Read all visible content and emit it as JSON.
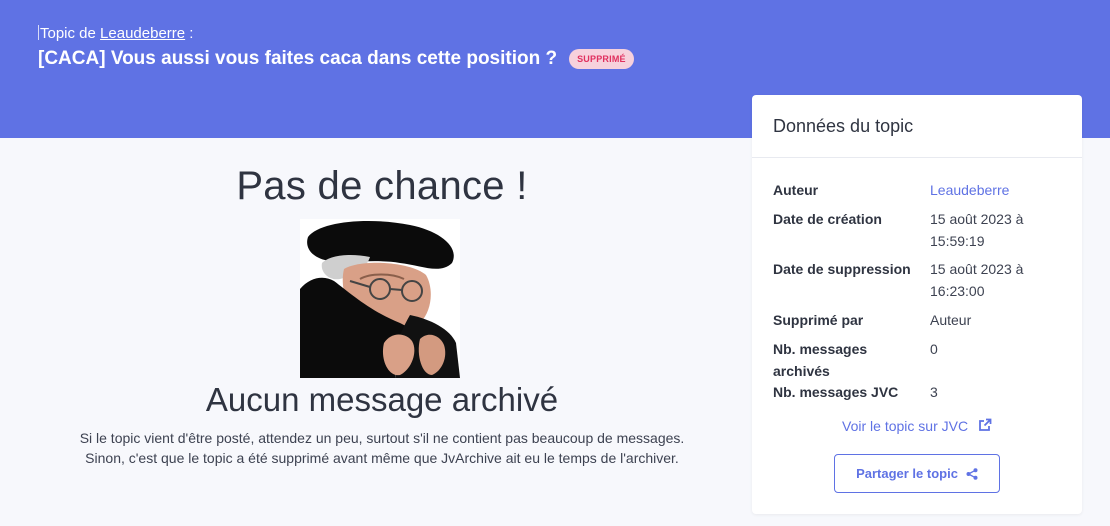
{
  "header": {
    "topic_prefix": "Topic de",
    "author": "Leaudeberre",
    "colon": " :",
    "title": "[CACA] Vous aussi vous faites caca dans cette position ?",
    "badge": "SUPPRIMÉ"
  },
  "main": {
    "heading": "Pas de chance !",
    "subheading": "Aucun message archivé",
    "line1": "Si le topic vient d'être posté, attendez un peu, surtout s'il ne contient pas beaucoup de messages.",
    "line2": "Sinon, c'est que le topic a été supprimé avant même que JvArchive ait eu le temps de l'archiver."
  },
  "card": {
    "title": "Données du topic",
    "rows": [
      {
        "label": "Auteur",
        "value": "Leaudeberre"
      },
      {
        "label": "Date de création",
        "value": "15 août 2023 à 15:59:19"
      },
      {
        "label": "Date de suppression",
        "value": "15 août 2023 à 16:23:00"
      },
      {
        "label": "Supprimé par",
        "value": "Auteur"
      },
      {
        "label": "Nb. messages archivés",
        "value": "0"
      },
      {
        "label": "Nb. messages JVC",
        "value": "3"
      }
    ],
    "jvc_link": "Voir le topic sur JVC",
    "share": "Partager le topic"
  },
  "colors": {
    "accent": "#5f72e4",
    "badge_bg": "#f7d1dc",
    "badge_text": "#e0305f"
  }
}
